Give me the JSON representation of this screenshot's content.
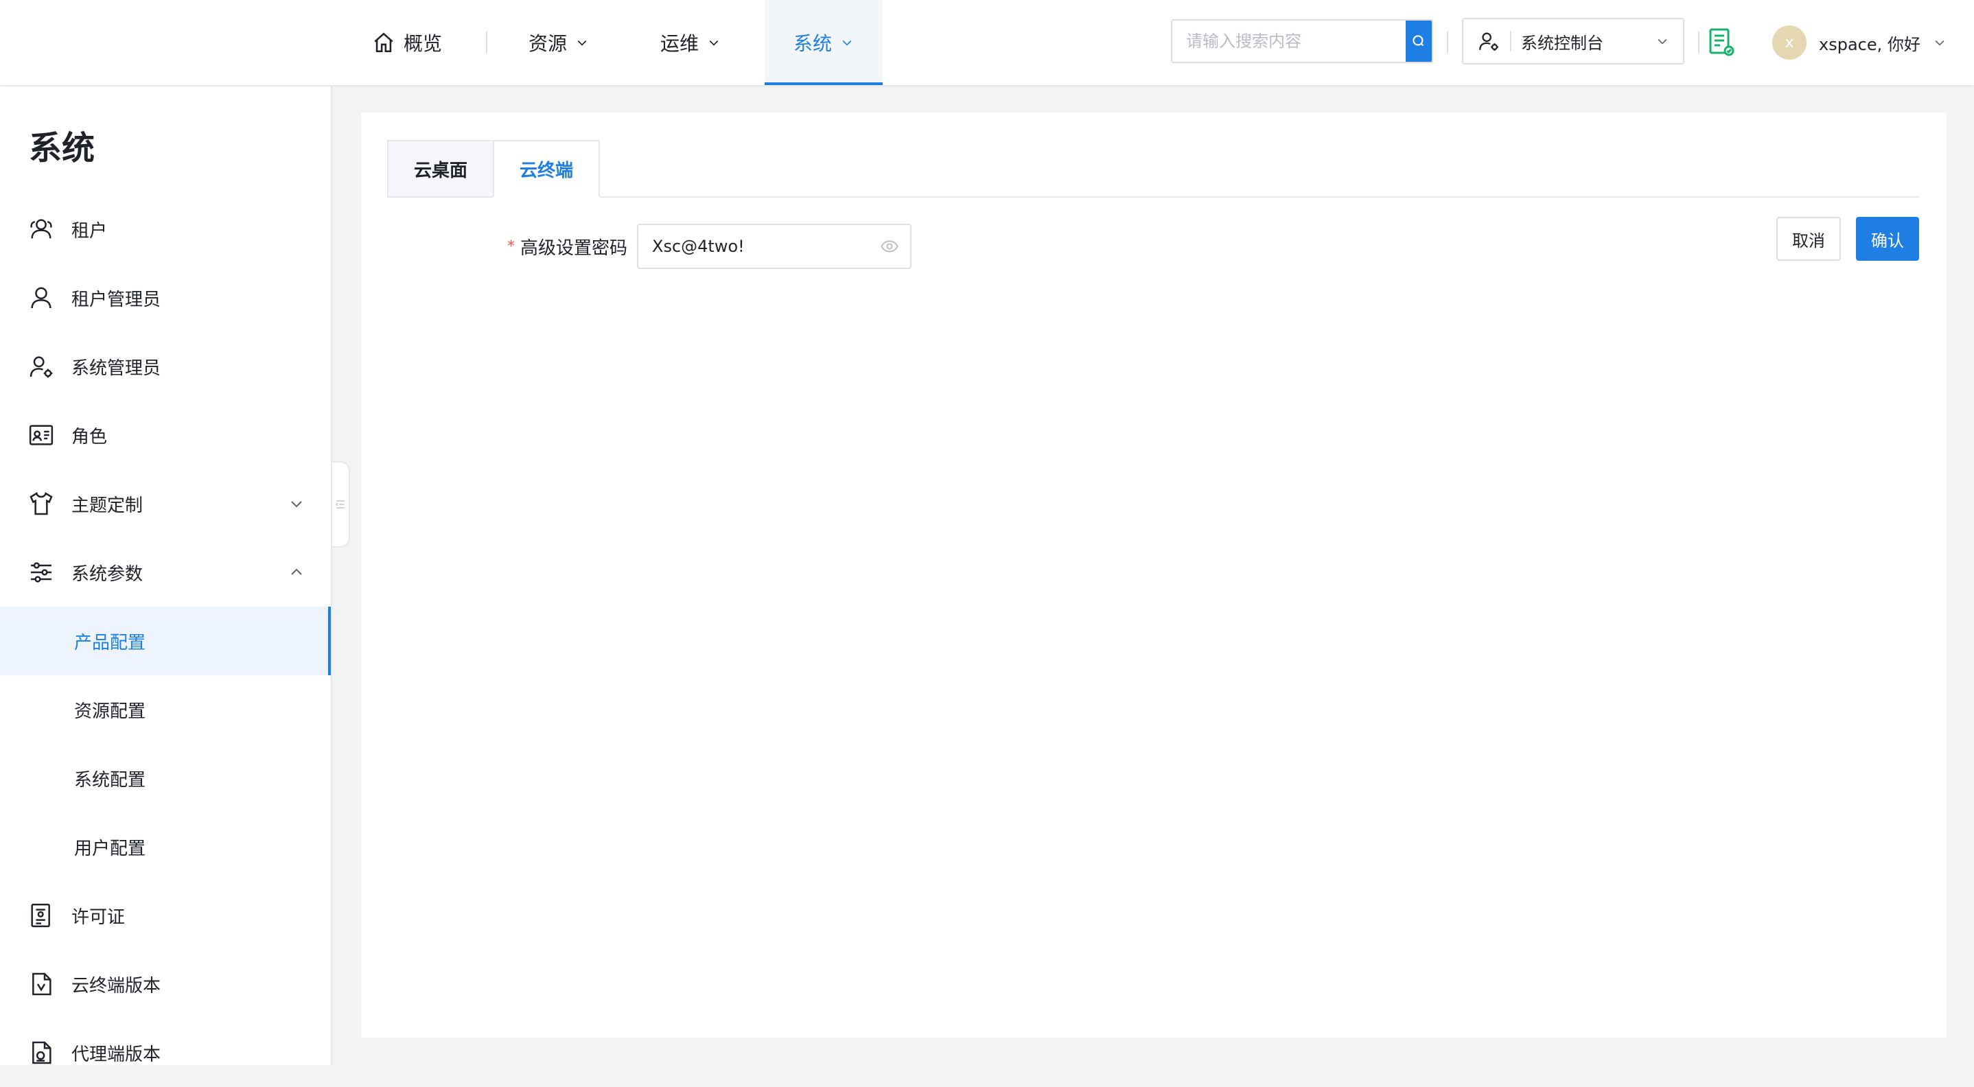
{
  "header": {
    "nav": [
      {
        "label": "概览",
        "icon": "home-icon"
      },
      {
        "label": "资源"
      },
      {
        "label": "运维"
      },
      {
        "label": "系统",
        "active": true
      }
    ],
    "search": {
      "placeholder": "请输入搜索内容",
      "value": ""
    },
    "console_select": {
      "value": "系统控制台"
    },
    "user": {
      "avatar_initial": "x",
      "greeting": "xspace, 你好"
    }
  },
  "sidebar": {
    "title": "系统",
    "items": [
      {
        "label": "租户",
        "icon": "tenant-icon"
      },
      {
        "label": "租户管理员",
        "icon": "user-icon"
      },
      {
        "label": "系统管理员",
        "icon": "user-gear-icon"
      },
      {
        "label": "角色",
        "icon": "id-card-icon"
      },
      {
        "label": "主题定制",
        "icon": "shirt-icon",
        "expanded": false
      },
      {
        "label": "系统参数",
        "icon": "sliders-icon",
        "expanded": true
      },
      {
        "label": "产品配置",
        "selected": true
      },
      {
        "label": "资源配置"
      },
      {
        "label": "系统配置"
      },
      {
        "label": "用户配置"
      },
      {
        "label": "许可证",
        "icon": "license-icon"
      },
      {
        "label": "云终端版本",
        "icon": "version-file-icon"
      },
      {
        "label": "代理端版本",
        "icon": "agent-version-icon"
      }
    ]
  },
  "main": {
    "tabs": [
      {
        "label": "云桌面"
      },
      {
        "label": "云终端",
        "active": true
      }
    ],
    "form": {
      "password_label": "高级设置密码",
      "required_mark": "*",
      "password_value": "Xsc@4two!"
    },
    "buttons": {
      "cancel": "取消",
      "confirm": "确认"
    }
  },
  "colors": {
    "accent": "#1e7ee4",
    "required": "#f5514c",
    "doc_icon": "#19b26b"
  }
}
